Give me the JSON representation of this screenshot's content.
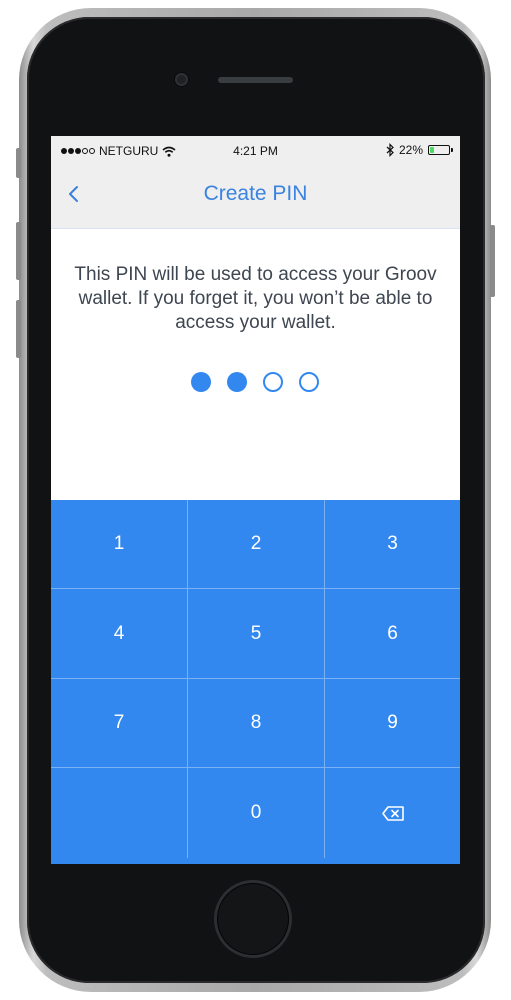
{
  "status_bar": {
    "carrier": "NETGURU",
    "time": "4:21 PM",
    "battery_percent": "22%",
    "battery_level": 0.22,
    "signal_bars_filled": 3,
    "signal_bars_total": 5
  },
  "nav": {
    "back_icon": "chevron-left-icon",
    "title": "Create PIN"
  },
  "message": "This PIN will be used to access your Groov wallet. If you forget it, you won’t be able to access your wallet.",
  "pin": {
    "length": 4,
    "entered": 2
  },
  "keypad": {
    "keys": [
      "1",
      "2",
      "3",
      "4",
      "5",
      "6",
      "7",
      "8",
      "9",
      "",
      "0",
      ""
    ],
    "delete_icon": "backspace-icon"
  },
  "colors": {
    "accent": "#3388f0",
    "nav_title": "#3a83e0",
    "bar_bg": "#efefef",
    "text": "#3e4651"
  }
}
